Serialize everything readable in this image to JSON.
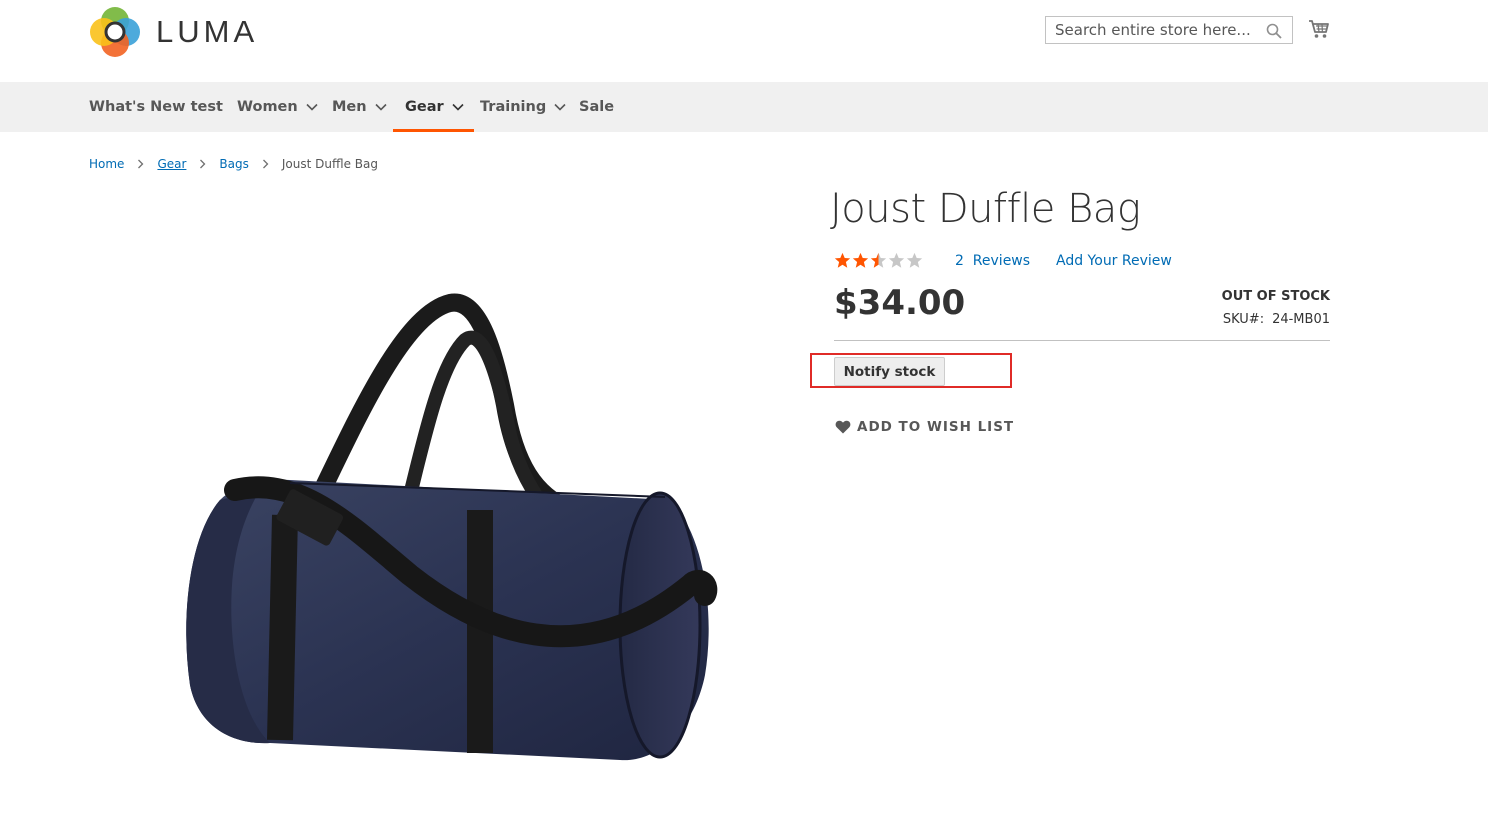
{
  "header": {
    "logo_text": "LUMA",
    "search_placeholder": "Search entire store here..."
  },
  "nav": {
    "items": [
      {
        "label": "What's New test",
        "has_dropdown": false
      },
      {
        "label": "Women",
        "has_dropdown": true
      },
      {
        "label": "Men",
        "has_dropdown": true
      },
      {
        "label": "Gear",
        "has_dropdown": true,
        "active": true
      },
      {
        "label": "Training",
        "has_dropdown": true
      },
      {
        "label": "Sale",
        "has_dropdown": false
      }
    ]
  },
  "breadcrumb": {
    "items": [
      "Home",
      "Gear",
      "Bags"
    ],
    "current": "Joust Duffle Bag"
  },
  "product": {
    "title": "Joust Duffle Bag",
    "rating_stars": 2.5,
    "rating_max": 5,
    "reviews_label": "2  Reviews",
    "add_review_label": "Add Your Review",
    "price": "$34.00",
    "stock_status": "OUT OF STOCK",
    "sku_label": "SKU#:",
    "sku_value": "24-MB01",
    "notify_button_label": "Notify stock",
    "wishlist_label": "ADD TO WISH LIST"
  },
  "colors": {
    "accent": "#ff5501",
    "link": "#006bb4",
    "highlight": "#e02b27",
    "star_filled": "#ff5501",
    "star_empty": "#c7c7c7"
  }
}
